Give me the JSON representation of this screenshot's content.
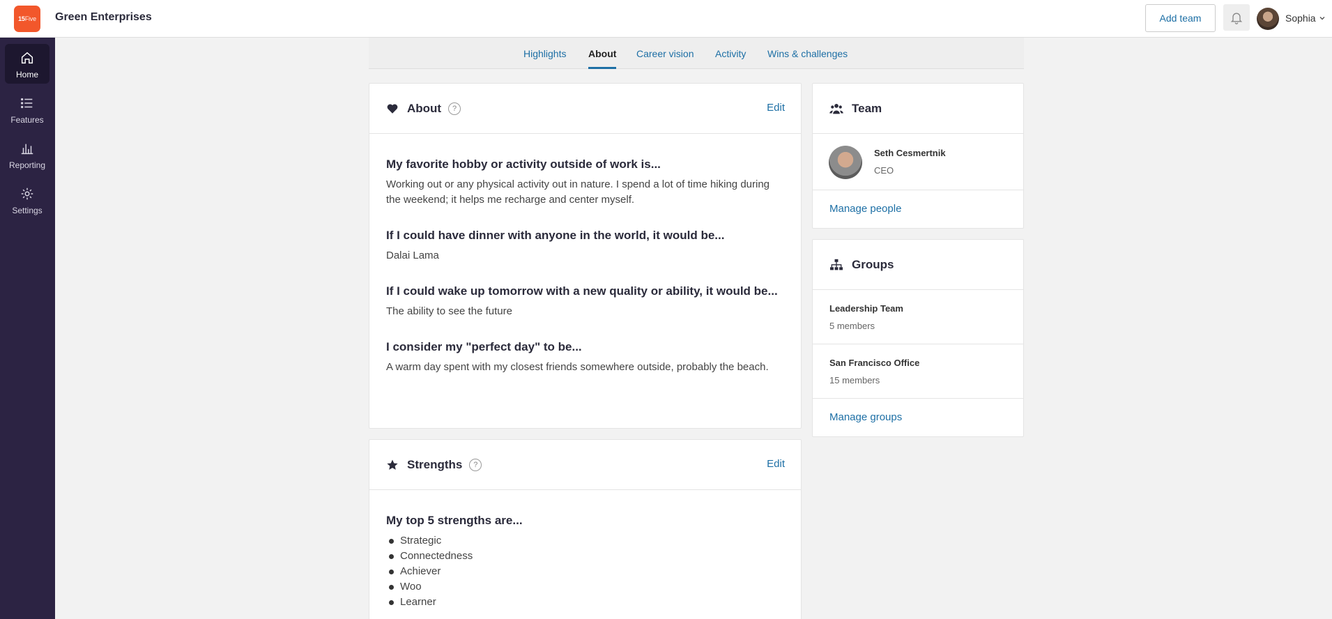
{
  "app": {
    "logo_text_a": "15",
    "logo_text_b": "Five",
    "company_name": "Green Enterprises",
    "accent_color": "#1d6fa5",
    "brand_color": "#f2572b",
    "sidebar_color": "#2c2343"
  },
  "header": {
    "add_team_label": "Add team",
    "bell_icon": "bell-icon",
    "user_name": "Sophia"
  },
  "sidebar": {
    "items": [
      {
        "label": "Home",
        "icon": "home-icon",
        "active": true
      },
      {
        "label": "Features",
        "icon": "list-icon",
        "active": false
      },
      {
        "label": "Reporting",
        "icon": "bar-chart-icon",
        "active": false
      },
      {
        "label": "Settings",
        "icon": "gear-icon",
        "active": false
      }
    ]
  },
  "tabs": [
    {
      "label": "Highlights",
      "active": false
    },
    {
      "label": "About",
      "active": true
    },
    {
      "label": "Career vision",
      "active": false
    },
    {
      "label": "Activity",
      "active": false
    },
    {
      "label": "Wins & challenges",
      "active": false
    }
  ],
  "about": {
    "title": "About",
    "help": "?",
    "edit_label": "Edit",
    "questions": [
      {
        "q": "My favorite hobby or activity outside of work is...",
        "a": "Working out or any physical activity out in nature. I spend a lot of time hiking during the weekend; it helps me recharge and center myself."
      },
      {
        "q": "If I could have dinner with anyone in the world, it would be...",
        "a": "Dalai Lama"
      },
      {
        "q": "If I could wake up tomorrow with a new quality or ability, it would be...",
        "a": "The ability to see the future"
      },
      {
        "q": "I consider my \"perfect day\" to be...",
        "a": "A warm day spent with my closest friends somewhere outside, probably the beach."
      }
    ]
  },
  "strengths": {
    "title": "Strengths",
    "help": "?",
    "edit_label": "Edit",
    "question": "My top 5 strengths are...",
    "items": [
      "Strategic",
      "Connectedness",
      "Achiever",
      "Woo",
      "Learner"
    ]
  },
  "team": {
    "title": "Team",
    "member_name": "Seth Cesmertnik",
    "member_role": "CEO",
    "manage_label": "Manage people"
  },
  "groups": {
    "title": "Groups",
    "items": [
      {
        "name": "Leadership Team",
        "members": "5 members"
      },
      {
        "name": "San Francisco Office",
        "members": "15 members"
      }
    ],
    "manage_label": "Manage groups"
  }
}
